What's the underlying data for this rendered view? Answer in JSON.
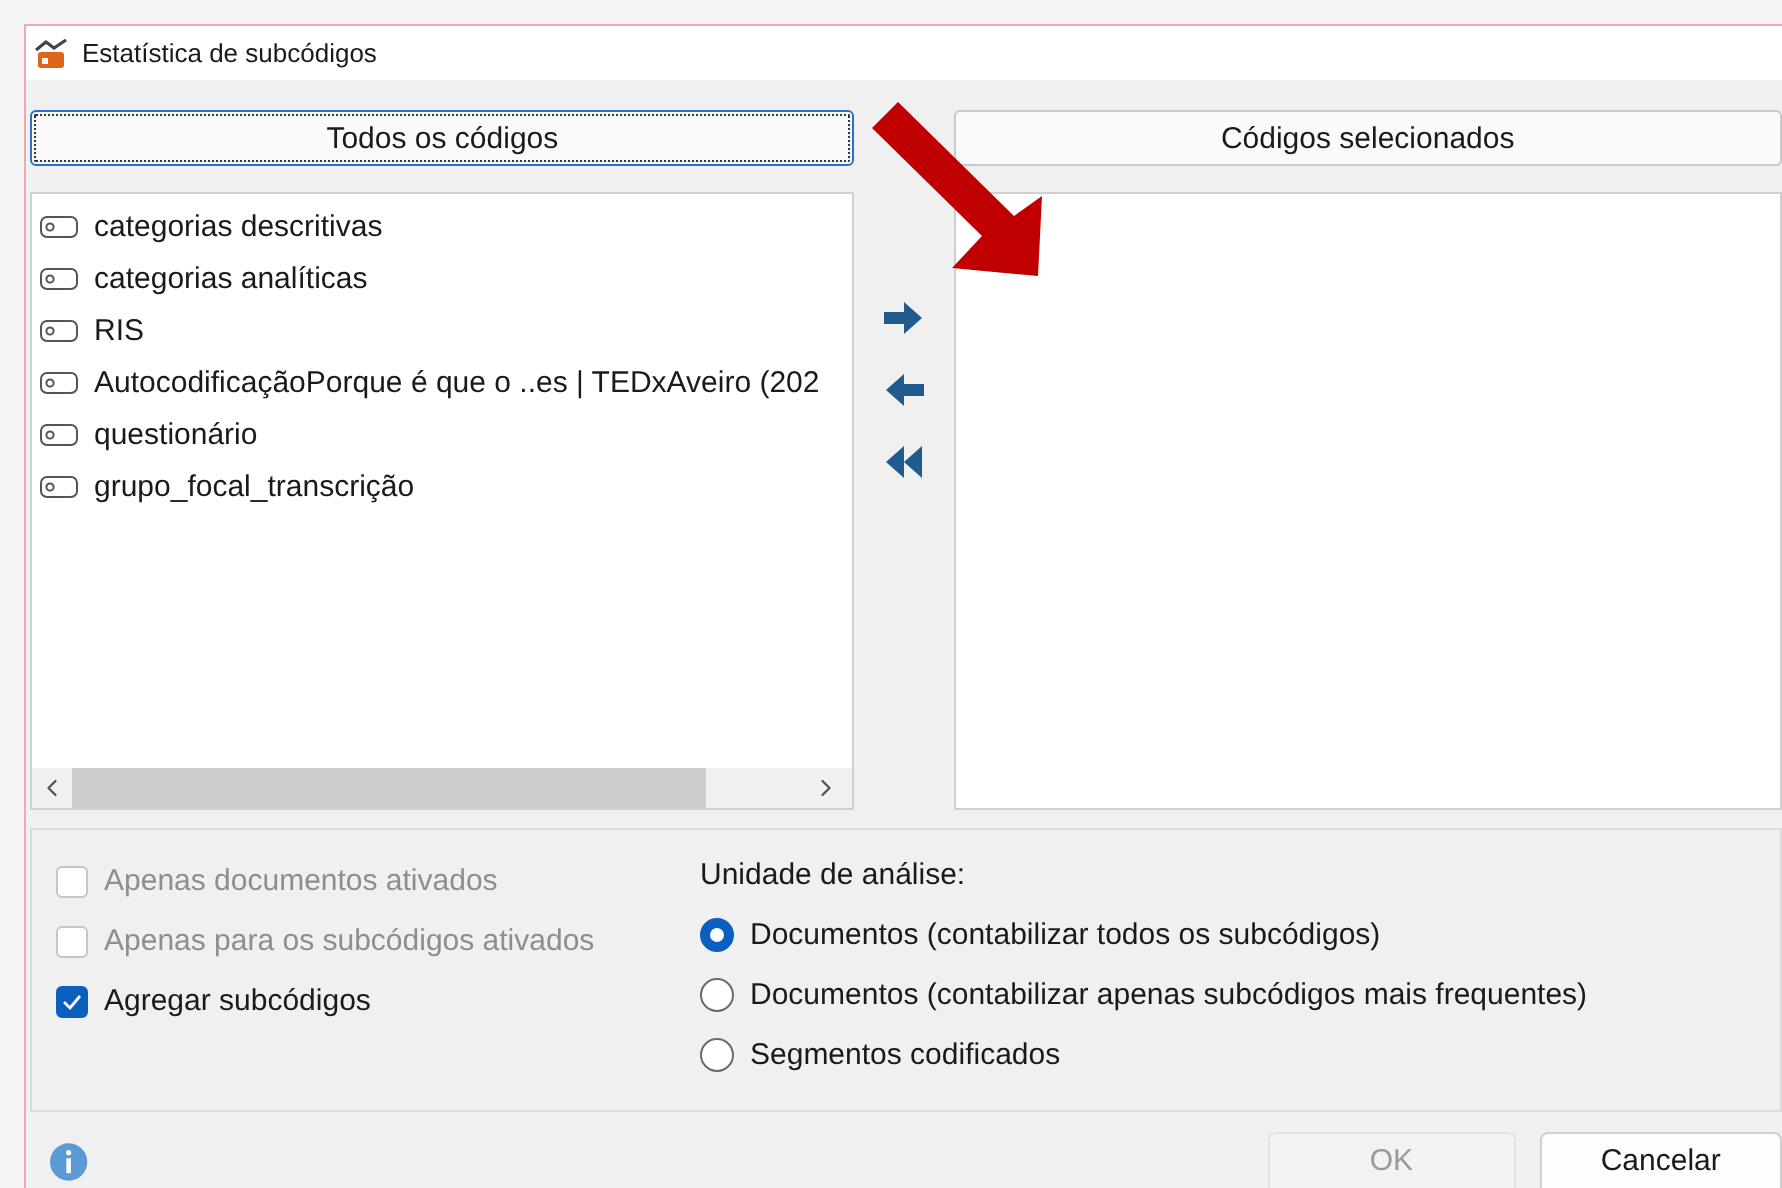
{
  "window": {
    "title": "Estatística de subcódigos"
  },
  "all_codes": {
    "header": "Todos os códigos",
    "focused": true,
    "items": [
      {
        "label": "categorias descritivas"
      },
      {
        "label": "categorias analíticas"
      },
      {
        "label": "RIS"
      },
      {
        "label": "AutocodificaçãoPorque é que o ..es | TEDxAveiro (202"
      },
      {
        "label": "questionário"
      },
      {
        "label": "grupo_focal_transcrição"
      }
    ]
  },
  "selected_codes": {
    "header": "Códigos selecionados",
    "focused": false
  },
  "checkboxes": [
    {
      "label": "Apenas documentos ativados",
      "checked": false,
      "disabled": true
    },
    {
      "label": "Apenas para os subcódigos ativados",
      "checked": false,
      "disabled": true
    },
    {
      "label": "Agregar subcódigos",
      "checked": true,
      "disabled": false
    }
  ],
  "analysis_unit": {
    "label": "Unidade de análise:",
    "options": [
      {
        "label": "Documentos (contabilizar todos os subcódigos)",
        "selected": true
      },
      {
        "label": "Documentos (contabilizar apenas subcódigos mais frequentes)",
        "selected": false
      },
      {
        "label": "Segmentos codificados",
        "selected": false
      }
    ]
  },
  "buttons": [
    {
      "label": "OK",
      "disabled": true
    },
    {
      "label": "Cancelar",
      "disabled": false
    }
  ]
}
